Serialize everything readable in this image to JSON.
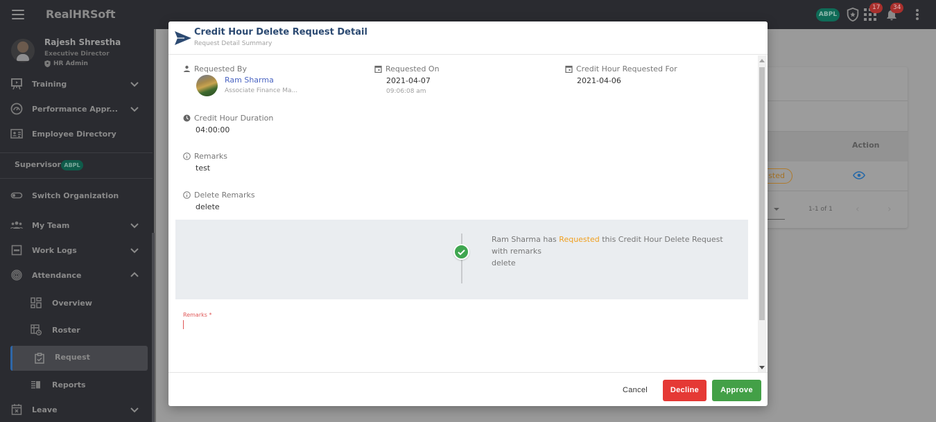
{
  "topbar": {
    "brand": "RealHRSoft",
    "org_badge": "ABPL",
    "apps_count": "17",
    "notifications_count": "34"
  },
  "profile": {
    "name": "Rajesh Shrestha",
    "role": "Executive Director",
    "group": "HR Admin"
  },
  "sidebar": {
    "items": [
      {
        "label": "Training",
        "icon": "training-icon"
      },
      {
        "label": "Performance Appr...",
        "icon": "performance-icon"
      },
      {
        "label": "Employee Directory",
        "icon": "directory-icon"
      }
    ],
    "supervisor_label": "Supervisor",
    "supervisor_badge": "ABPL",
    "switch_org": "Switch Organization",
    "team_items": [
      {
        "label": "My Team"
      },
      {
        "label": "Work Logs"
      },
      {
        "label": "Attendance"
      }
    ],
    "attendance_sub": [
      {
        "label": "Overview"
      },
      {
        "label": "Roster"
      },
      {
        "label": "Request",
        "active": true
      },
      {
        "label": "Reports"
      }
    ],
    "leave": "Leave"
  },
  "background": {
    "action_header": "Action",
    "status_partial": "sted",
    "pager": "1-1 of 1"
  },
  "modal": {
    "title": "Credit Hour Delete Request Detail",
    "subtitle": "Request Detail Summary",
    "requested_by_label": "Requested By",
    "requester_name": "Ram Sharma",
    "requester_title": "Associate Finance Ma...",
    "requested_on_label": "Requested On",
    "requested_on_date": "2021-04-07",
    "requested_on_time": "09:06:08 am",
    "requested_for_label": "Credit Hour Requested For",
    "requested_for_date": "2021-04-06",
    "duration_label": "Credit Hour Duration",
    "duration_value": "04:00:00",
    "remarks_label": "Remarks",
    "remarks_value": "test",
    "delete_remarks_label": "Delete Remarks",
    "delete_remarks_value": "delete",
    "timeline": {
      "actor": "Ram Sharma",
      "pre": "has",
      "status": "Requested",
      "post": "this Credit Hour Delete Request",
      "line2": "with remarks",
      "remark": "delete",
      "status_color": "#f0a020"
    },
    "remarks_input_label": "Remarks *",
    "remarks_input_value": "",
    "buttons": {
      "cancel": "Cancel",
      "decline": "Decline",
      "approve": "Approve"
    }
  }
}
